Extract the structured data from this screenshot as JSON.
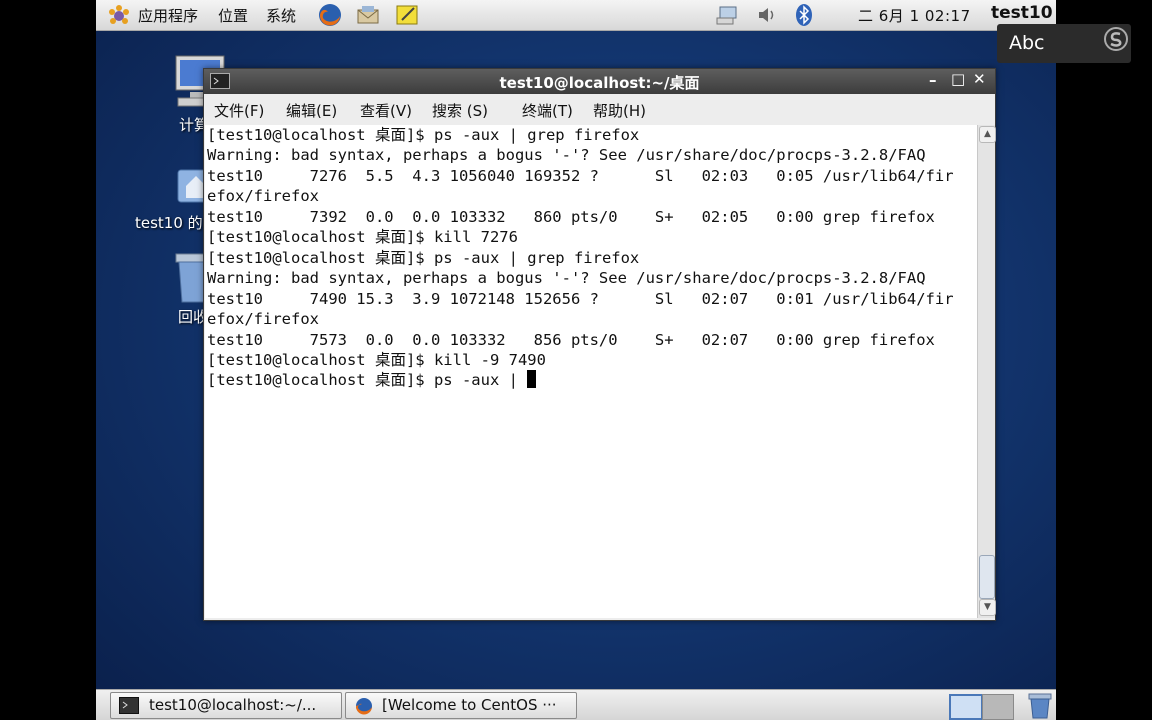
{
  "top_panel": {
    "menus": [
      "应用程序",
      "位置",
      "系统"
    ],
    "clock": "二 6月  1 02:17",
    "user": "test10"
  },
  "ime": {
    "label": "Abc"
  },
  "desktop_icons": [
    {
      "label": "计算"
    },
    {
      "label": "test10 的"
    },
    {
      "label": "回收"
    }
  ],
  "terminal": {
    "title": "test10@localhost:~/桌面",
    "menu": [
      "文件(F)",
      "编辑(E)",
      "查看(V)",
      "搜索 (S)",
      "终端(T)",
      "帮助(H)"
    ],
    "lines": [
      "[test10@localhost 桌面]$ ps -aux | grep firefox",
      "Warning: bad syntax, perhaps a bogus '-'? See /usr/share/doc/procps-3.2.8/FAQ",
      "test10     7276  5.5  4.3 1056040 169352 ?      Sl   02:03   0:05 /usr/lib64/fir",
      "efox/firefox",
      "test10     7392  0.0  0.0 103332   860 pts/0    S+   02:05   0:00 grep firefox",
      "[test10@localhost 桌面]$ kill 7276",
      "[test10@localhost 桌面]$ ps -aux | grep firefox",
      "Warning: bad syntax, perhaps a bogus '-'? See /usr/share/doc/procps-3.2.8/FAQ",
      "test10     7490 15.3  3.9 1072148 152656 ?      Sl   02:07   0:01 /usr/lib64/fir",
      "efox/firefox",
      "test10     7573  0.0  0.0 103332   856 pts/0    S+   02:07   0:00 grep firefox",
      "[test10@localhost 桌面]$ kill -9 7490"
    ],
    "prompt_line": "[test10@localhost 桌面]$ ps -aux | "
  },
  "taskbar": {
    "tasks": [
      {
        "label": "test10@localhost:~/..."
      },
      {
        "label": "[Welcome to CentOS ···"
      }
    ]
  }
}
